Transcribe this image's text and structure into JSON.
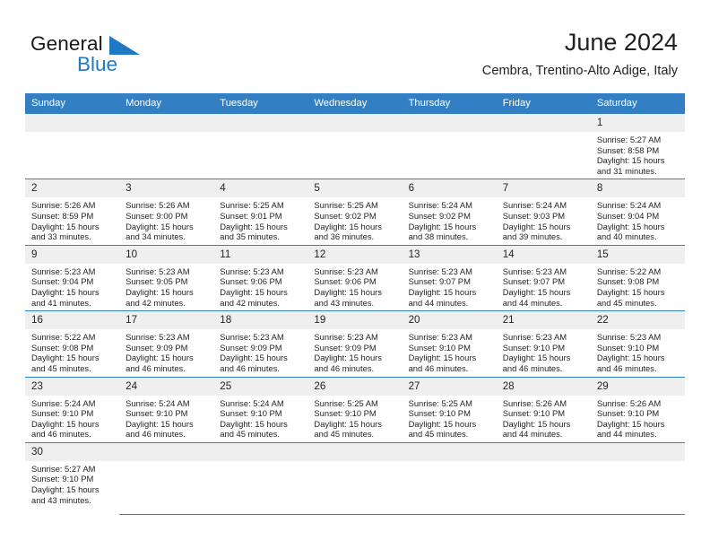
{
  "brand": {
    "name_top": "General",
    "name_bottom": "Blue",
    "flag_icon": "blue-triangle-flag-icon",
    "color_primary": "#1f78c1",
    "color_text": "#1a1a1a"
  },
  "header": {
    "title": "June 2024",
    "subtitle": "Cembra, Trentino-Alto Adige, Italy"
  },
  "theme": {
    "header_bg": "#3280c3",
    "header_text": "#ffffff",
    "daynum_bg": "#efefef",
    "row_divider": "#3280c3",
    "body_text": "#231f20"
  },
  "calendar": {
    "weekday_headers": [
      "Sunday",
      "Monday",
      "Tuesday",
      "Wednesday",
      "Thursday",
      "Friday",
      "Saturday"
    ],
    "weeks": [
      [
        {
          "day": ""
        },
        {
          "day": ""
        },
        {
          "day": ""
        },
        {
          "day": ""
        },
        {
          "day": ""
        },
        {
          "day": ""
        },
        {
          "day": "1",
          "sunrise": "Sunrise: 5:27 AM",
          "sunset": "Sunset: 8:58 PM",
          "daylight": "Daylight: 15 hours and 31 minutes."
        }
      ],
      [
        {
          "day": "2",
          "sunrise": "Sunrise: 5:26 AM",
          "sunset": "Sunset: 8:59 PM",
          "daylight": "Daylight: 15 hours and 33 minutes."
        },
        {
          "day": "3",
          "sunrise": "Sunrise: 5:26 AM",
          "sunset": "Sunset: 9:00 PM",
          "daylight": "Daylight: 15 hours and 34 minutes."
        },
        {
          "day": "4",
          "sunrise": "Sunrise: 5:25 AM",
          "sunset": "Sunset: 9:01 PM",
          "daylight": "Daylight: 15 hours and 35 minutes."
        },
        {
          "day": "5",
          "sunrise": "Sunrise: 5:25 AM",
          "sunset": "Sunset: 9:02 PM",
          "daylight": "Daylight: 15 hours and 36 minutes."
        },
        {
          "day": "6",
          "sunrise": "Sunrise: 5:24 AM",
          "sunset": "Sunset: 9:02 PM",
          "daylight": "Daylight: 15 hours and 38 minutes."
        },
        {
          "day": "7",
          "sunrise": "Sunrise: 5:24 AM",
          "sunset": "Sunset: 9:03 PM",
          "daylight": "Daylight: 15 hours and 39 minutes."
        },
        {
          "day": "8",
          "sunrise": "Sunrise: 5:24 AM",
          "sunset": "Sunset: 9:04 PM",
          "daylight": "Daylight: 15 hours and 40 minutes."
        }
      ],
      [
        {
          "day": "9",
          "sunrise": "Sunrise: 5:23 AM",
          "sunset": "Sunset: 9:04 PM",
          "daylight": "Daylight: 15 hours and 41 minutes."
        },
        {
          "day": "10",
          "sunrise": "Sunrise: 5:23 AM",
          "sunset": "Sunset: 9:05 PM",
          "daylight": "Daylight: 15 hours and 42 minutes."
        },
        {
          "day": "11",
          "sunrise": "Sunrise: 5:23 AM",
          "sunset": "Sunset: 9:06 PM",
          "daylight": "Daylight: 15 hours and 42 minutes."
        },
        {
          "day": "12",
          "sunrise": "Sunrise: 5:23 AM",
          "sunset": "Sunset: 9:06 PM",
          "daylight": "Daylight: 15 hours and 43 minutes."
        },
        {
          "day": "13",
          "sunrise": "Sunrise: 5:23 AM",
          "sunset": "Sunset: 9:07 PM",
          "daylight": "Daylight: 15 hours and 44 minutes."
        },
        {
          "day": "14",
          "sunrise": "Sunrise: 5:23 AM",
          "sunset": "Sunset: 9:07 PM",
          "daylight": "Daylight: 15 hours and 44 minutes."
        },
        {
          "day": "15",
          "sunrise": "Sunrise: 5:22 AM",
          "sunset": "Sunset: 9:08 PM",
          "daylight": "Daylight: 15 hours and 45 minutes."
        }
      ],
      [
        {
          "day": "16",
          "sunrise": "Sunrise: 5:22 AM",
          "sunset": "Sunset: 9:08 PM",
          "daylight": "Daylight: 15 hours and 45 minutes."
        },
        {
          "day": "17",
          "sunrise": "Sunrise: 5:23 AM",
          "sunset": "Sunset: 9:09 PM",
          "daylight": "Daylight: 15 hours and 46 minutes."
        },
        {
          "day": "18",
          "sunrise": "Sunrise: 5:23 AM",
          "sunset": "Sunset: 9:09 PM",
          "daylight": "Daylight: 15 hours and 46 minutes."
        },
        {
          "day": "19",
          "sunrise": "Sunrise: 5:23 AM",
          "sunset": "Sunset: 9:09 PM",
          "daylight": "Daylight: 15 hours and 46 minutes."
        },
        {
          "day": "20",
          "sunrise": "Sunrise: 5:23 AM",
          "sunset": "Sunset: 9:10 PM",
          "daylight": "Daylight: 15 hours and 46 minutes."
        },
        {
          "day": "21",
          "sunrise": "Sunrise: 5:23 AM",
          "sunset": "Sunset: 9:10 PM",
          "daylight": "Daylight: 15 hours and 46 minutes."
        },
        {
          "day": "22",
          "sunrise": "Sunrise: 5:23 AM",
          "sunset": "Sunset: 9:10 PM",
          "daylight": "Daylight: 15 hours and 46 minutes."
        }
      ],
      [
        {
          "day": "23",
          "sunrise": "Sunrise: 5:24 AM",
          "sunset": "Sunset: 9:10 PM",
          "daylight": "Daylight: 15 hours and 46 minutes."
        },
        {
          "day": "24",
          "sunrise": "Sunrise: 5:24 AM",
          "sunset": "Sunset: 9:10 PM",
          "daylight": "Daylight: 15 hours and 46 minutes."
        },
        {
          "day": "25",
          "sunrise": "Sunrise: 5:24 AM",
          "sunset": "Sunset: 9:10 PM",
          "daylight": "Daylight: 15 hours and 45 minutes."
        },
        {
          "day": "26",
          "sunrise": "Sunrise: 5:25 AM",
          "sunset": "Sunset: 9:10 PM",
          "daylight": "Daylight: 15 hours and 45 minutes."
        },
        {
          "day": "27",
          "sunrise": "Sunrise: 5:25 AM",
          "sunset": "Sunset: 9:10 PM",
          "daylight": "Daylight: 15 hours and 45 minutes."
        },
        {
          "day": "28",
          "sunrise": "Sunrise: 5:26 AM",
          "sunset": "Sunset: 9:10 PM",
          "daylight": "Daylight: 15 hours and 44 minutes."
        },
        {
          "day": "29",
          "sunrise": "Sunrise: 5:26 AM",
          "sunset": "Sunset: 9:10 PM",
          "daylight": "Daylight: 15 hours and 44 minutes."
        }
      ],
      [
        {
          "day": "30",
          "sunrise": "Sunrise: 5:27 AM",
          "sunset": "Sunset: 9:10 PM",
          "daylight": "Daylight: 15 hours and 43 minutes."
        },
        {
          "day": ""
        },
        {
          "day": ""
        },
        {
          "day": ""
        },
        {
          "day": ""
        },
        {
          "day": ""
        },
        {
          "day": ""
        }
      ]
    ]
  }
}
